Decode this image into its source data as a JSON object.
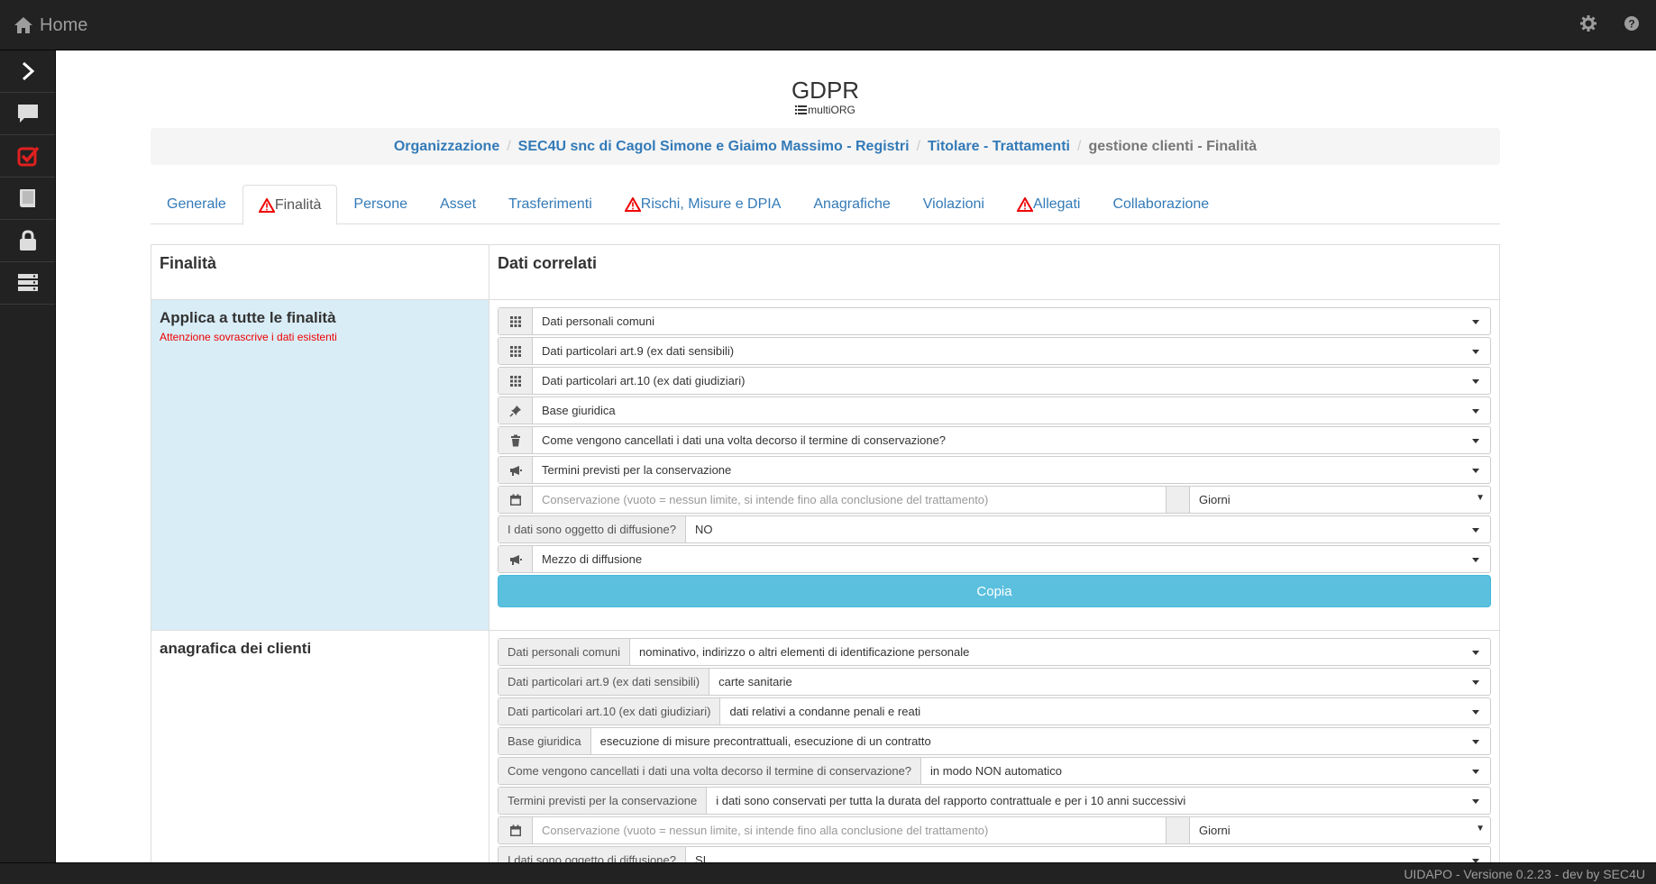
{
  "topbar": {
    "home_label": "Home",
    "home_icon": "home-icon",
    "settings_icon": "gear-icon",
    "help_icon": "question-icon"
  },
  "sidebar": {
    "items": [
      "chevron-right-icon",
      "comment-icon",
      "check-square-icon",
      "book-icon",
      "lock-icon",
      "server-icon"
    ]
  },
  "page": {
    "title": "GDPR",
    "subtitle": "multiORG"
  },
  "breadcrumb": {
    "items": [
      "Organizzazione",
      "SEC4U snc di Cagol Simone e Giaimo Massimo - Registri",
      "Titolare - Trattamenti"
    ],
    "active": "gestione clienti - Finalità"
  },
  "tabs": [
    {
      "label": "Generale",
      "warn": false,
      "active": false
    },
    {
      "label": "Finalità",
      "warn": true,
      "active": true
    },
    {
      "label": "Persone",
      "warn": false,
      "active": false
    },
    {
      "label": "Asset",
      "warn": false,
      "active": false
    },
    {
      "label": "Trasferimenti",
      "warn": false,
      "active": false
    },
    {
      "label": "Rischi, Misure e DPIA",
      "warn": true,
      "active": false
    },
    {
      "label": "Anagrafiche",
      "warn": false,
      "active": false
    },
    {
      "label": "Violazioni",
      "warn": false,
      "active": false
    },
    {
      "label": "Allegati",
      "warn": true,
      "active": false
    },
    {
      "label": "Collaborazione",
      "warn": false,
      "active": false
    }
  ],
  "table": {
    "col_left": "Finalità",
    "col_right": "Dati correlati",
    "apply_all": {
      "title": "Applica a tutte le finalità",
      "warning": "Attenzione sovrascrive i dati esistenti",
      "dati_comuni": "Dati personali comuni",
      "dati_art9": "Dati particolari art.9 (ex dati sensibili)",
      "dati_art10": "Dati particolari art.10 (ex dati giudiziari)",
      "base_giuridica": "Base giuridica",
      "cancellazione": "Come vengono cancellati i dati una volta decorso il termine di conservazione?",
      "termini": "Termini previsti per la conservazione",
      "conservazione_placeholder": "Conservazione (vuoto = nessun limite, si intende fino alla conclusione del trattamento)",
      "unit": "Giorni",
      "diffusione_label": "I dati sono oggetto di diffusione?",
      "diffusione_value": "NO",
      "mezzo": "Mezzo di diffusione",
      "copy_button": "Copia"
    },
    "row1": {
      "title": "anagrafica dei clienti",
      "dati_comuni_label": "Dati personali comuni",
      "dati_comuni_value": "nominativo, indirizzo o altri elementi di identificazione personale",
      "art9_label": "Dati particolari art.9 (ex dati sensibili)",
      "art9_value": "carte sanitarie",
      "art10_label": "Dati particolari art.10 (ex dati giudiziari)",
      "art10_value": "dati relativi a condanne penali e reati",
      "base_label": "Base giuridica",
      "base_value": "esecuzione di misure precontrattuali, esecuzione di un contratto",
      "canc_label": "Come vengono cancellati i dati una volta decorso il termine di conservazione?",
      "canc_value": "in modo NON automatico",
      "termini_label": "Termini previsti per la conservazione",
      "termini_value": "i dati sono conservati per tutta la durata del rapporto contrattuale e per i 10 anni successivi",
      "conservazione_placeholder": "Conservazione (vuoto = nessun limite, si intende fino alla conclusione del trattamento)",
      "unit": "Giorni",
      "diffusione_label": "I dati sono oggetto di diffusione?",
      "diffusione_value": "SI"
    }
  },
  "footer": {
    "version": "UIDAPO - Versione 0.2.23 - dev by SEC4U"
  },
  "colors": {
    "link": "#337ab7",
    "info_bg": "#d9edf7",
    "copy_btn": "#5bc0de",
    "warning": "#e00000",
    "navbar": "#222222"
  }
}
